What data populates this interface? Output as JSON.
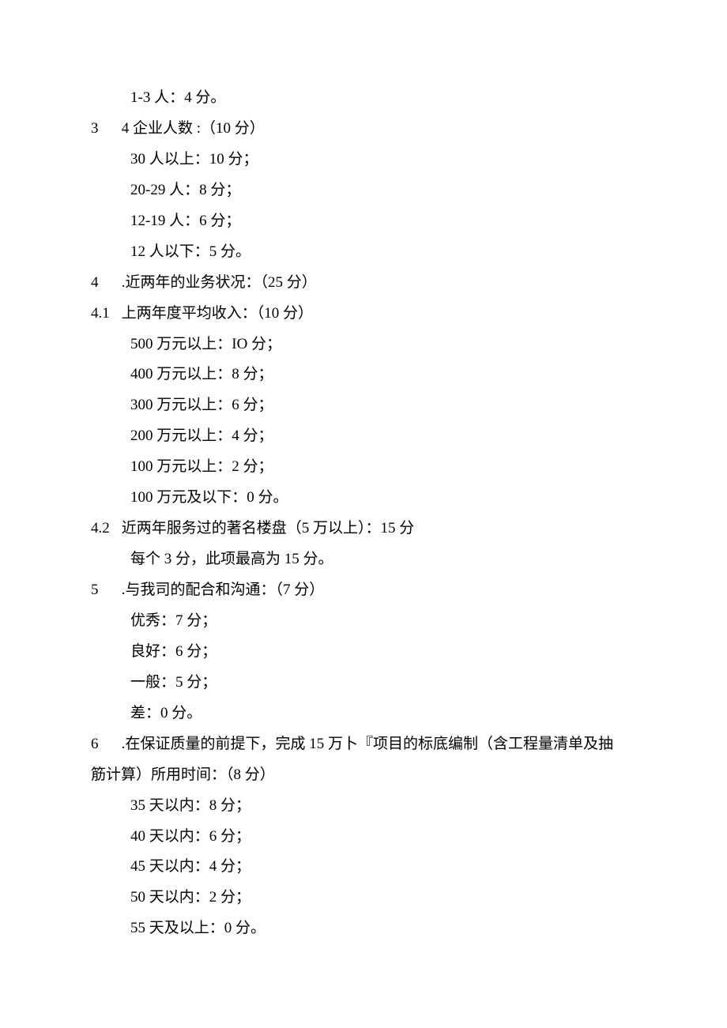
{
  "lines": {
    "l01": "1-3 人：4 分。",
    "l02_num": "3",
    "l02_txt": "4 企业人数 :（10 分）",
    "l03": "30 人以上：10 分；",
    "l04": "20-29 人：8 分；",
    "l05": "12-19 人：6 分；",
    "l06": "12 人以下：5 分。",
    "l07_num": "4",
    "l07_txt": ".近两年的业务状况：（25 分）",
    "l08_num": "4.1",
    "l08_txt": "上两年度平均收入：（10 分）",
    "l09": "500 万元以上：IO 分；",
    "l10": "400 万元以上：8 分；",
    "l11": "300 万元以上：6 分；",
    "l12": "200 万元以上：4 分；",
    "l13": "100 万元以上：2 分；",
    "l14": "100 万元及以下：0 分。",
    "l15_num": "4.2",
    "l15_txt": "近两年服务过的著名楼盘（5 万以上）：15 分",
    "l16": "每个 3 分，此项最高为 15 分。",
    "l17_num": "5",
    "l17_txt": ".与我司的配合和沟通：（7 分）",
    "l18": "优秀：7 分；",
    "l19": "良好：6 分；",
    "l20": "一般：5 分；",
    "l21": "差：0 分。",
    "l22_num": "6",
    "l22_txt": ".在保证质量的前提下，完成 15 万卜『项目的标底编制（含工程量清单及抽",
    "l23": "筋计算）所用时间：（8 分）",
    "l24": "35 天以内：8 分；",
    "l25": "40 天以内：6 分；",
    "l26": "45 天以内：4 分；",
    "l27": "50 天以内：2 分；",
    "l28": "55 天及以上：0 分。"
  }
}
